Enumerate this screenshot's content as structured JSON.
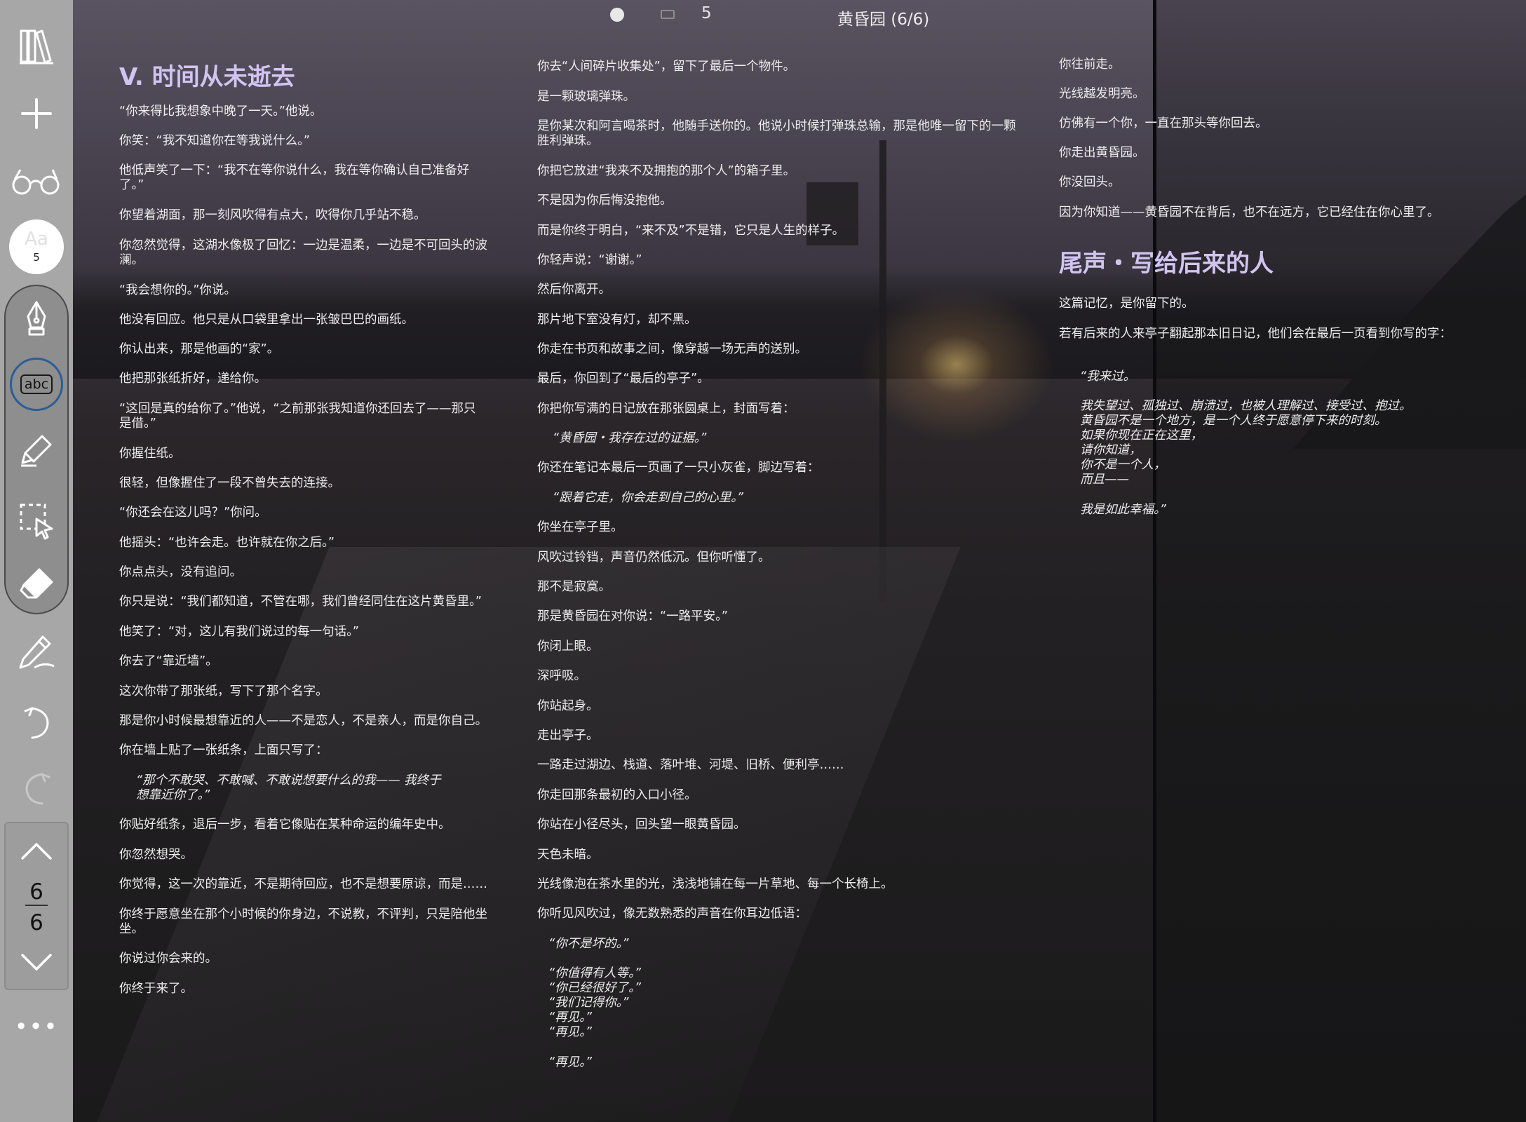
{
  "topbar": {
    "page_number": "5",
    "title": "黄昏园 (6/6)"
  },
  "toolbar": {
    "font_size": "5",
    "font_preview": "Aa",
    "abc_label": "abc",
    "current_page": "6",
    "total_pages": "6",
    "more_label": "•••"
  },
  "col1": {
    "heading": "V. 时间从未逝去",
    "p1": "“你来得比我想象中晚了一天。”他说。",
    "p2": "你笑：“我不知道你在等我说什么。”",
    "p3a": "他低声笑了一下：“我不在等你说什么，我在等你确认自己准备好",
    "p3b": "了。”",
    "p4": "你望着湖面，那一刻风吹得有点大，吹得你几乎站不稳。",
    "p5a": "你忽然觉得，这湖水像极了回忆：一边是温柔，一边是不可回头的波",
    "p5b": "澜。",
    "p6": "“我会想你的。”你说。",
    "p7": "他没有回应。他只是从口袋里拿出一张皱巴巴的画纸。",
    "p8": "你认出来，那是他画的“家”。",
    "p9": "他把那张纸折好，递给你。",
    "p10a": "“这回是真的给你了。”他说，“之前那张我知道你还回去了——那只",
    "p10b": "是借。”",
    "p11": "你握住纸。",
    "p12": "很轻，但像握住了一段不曾失去的连接。",
    "p13": "“你还会在这儿吗？”你问。",
    "p14": "他摇头：“也许会走。也许就在你之后。”",
    "p15": "你点点头，没有追问。",
    "p16": "你只是说：“我们都知道，不管在哪，我们曾经同住在这片黄昏里。”",
    "p17": "他笑了：“对，这儿有我们说过的每一句话。”",
    "p18": "你去了“靠近墙”。",
    "p19": "这次你带了那张纸，写下了那个名字。",
    "p20": "那是你小时候最想靠近的人——不是恋人，不是亲人，而是你自己。",
    "p21": "你在墙上贴了一张纸条，上面只写了：",
    "q1a": "“那个不敢哭、不敢喊、不敢说想要什么的我—— 我终于",
    "q1b": "想靠近你了。”",
    "p22": "你贴好纸条，退后一步，看着它像贴在某种命运的编年史中。",
    "p23": "你忽然想哭。",
    "p24": "你觉得，这一次的靠近，不是期待回应，也不是想要原谅，而是……",
    "p25a": "你终于愿意坐在那个小时候的你身边，不说教，不评判，只是陪他坐",
    "p25b": "坐。",
    "p26": "你说过你会来的。",
    "p27": "你终于来了。"
  },
  "col2": {
    "p1": "你去“人间碎片收集处”，留下了最后一个物件。",
    "p2": "是一颗玻璃弹珠。",
    "p3a": "是你某次和阿言喝茶时，他随手送你的。他说小时候打弹珠总输，那是他唯一留下的一颗",
    "p3b": "胜利弹珠。",
    "p4": "你把它放进“我来不及拥抱的那个人”的箱子里。",
    "p5": "不是因为你后悔没抱他。",
    "p6": "而是你终于明白，“来不及”不是错，它只是人生的样子。",
    "p7": "你轻声说：“谢谢。”",
    "p8": "然后你离开。",
    "p9": "那片地下室没有灯，却不黑。",
    "p10": "你走在书页和故事之间，像穿越一场无声的送别。",
    "p11": "最后，你回到了“最后的亭子”。",
    "p12": "你把你写满的日记放在那张圆桌上，封面写着：",
    "q1": "“黄昏园・我存在过的证据。”",
    "p13": "你还在笔记本最后一页画了一只小灰雀，脚边写着：",
    "q2": "“跟着它走，你会走到自己的心里。”",
    "p14": "你坐在亭子里。",
    "p15": "风吹过铃铛，声音仍然低沉。但你听懂了。",
    "p16": "那不是寂寞。",
    "p17": "那是黄昏园在对你说：“一路平安。”",
    "p18": "你闭上眼。",
    "p19": "深呼吸。",
    "p20": "你站起身。",
    "p21": "走出亭子。",
    "p22": "一路走过湖边、栈道、落叶堆、河堤、旧桥、便利亭……",
    "p23": "你走回那条最初的入口小径。",
    "p24": "你站在小径尽头，回头望一眼黄昏园。",
    "p25": "天色未暗。",
    "p26": "光线像泡在茶水里的光，浅浅地铺在每一片草地、每一个长椅上。",
    "p27": "你听见风吹过，像无数熟悉的声音在你耳边低语：",
    "q3": "“你不是坏的。”",
    "q4": "“你值得有人等。”",
    "q5": "“你已经很好了。”",
    "q6": "“我们记得你。”",
    "q7": "“再见。”",
    "q8": "“再见。”",
    "q9": "“再见。”"
  },
  "col3": {
    "p1": "你往前走。",
    "p2": "光线越发明亮。",
    "p3": "仿佛有一个你，一直在那头等你回去。",
    "p4": "你走出黄昏园。",
    "p5": "你没回头。",
    "p6": "因为你知道——黄昏园不在背后，也不在远方，它已经住在你心里了。",
    "heading": "尾声・写给后来的人",
    "p7": "这篇记忆，是你留下的。",
    "p8": "若有后来的人来亭子翻起那本旧日记，他们会在最后一页看到你写的字：",
    "q1": "“我来过。",
    "q2": "我失望过、孤独过、崩溃过，也被人理解过、接受过、抱过。",
    "q3": "黄昏园不是一个地方，是一个人终于愿意停下来的时刻。",
    "q4": "如果你现在正在这里，",
    "q5": "请你知道，",
    "q6": "你不是一个人，",
    "q7": "而且——",
    "q8": "我是如此幸福。”"
  },
  "colors": {
    "heading": "#d2c4f2",
    "toolbar_bg": "#a7a7a7",
    "abc_ring": "#2c5e94"
  },
  "icons": [
    "library-icon",
    "plus-icon",
    "glasses-icon",
    "pen-icon",
    "highlighter-icon",
    "lasso-select-icon",
    "eraser-icon",
    "pencil-icon",
    "undo-icon",
    "redo-icon",
    "chevron-up-icon",
    "chevron-down-icon",
    "more-icon"
  ]
}
